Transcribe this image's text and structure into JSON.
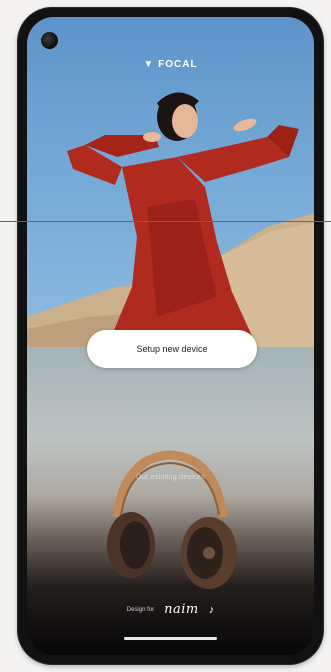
{
  "brand": {
    "logo_text": "FOCAL"
  },
  "actions": {
    "setup_label": "Setup new device"
  },
  "overlay": {
    "faded_text": "Our existing devices"
  },
  "footer": {
    "design_for": "Design for",
    "naim_logo": "naim"
  },
  "colors": {
    "sky": "#74a8d6",
    "dress": "#b3281e",
    "button_bg": "#ffffff"
  }
}
